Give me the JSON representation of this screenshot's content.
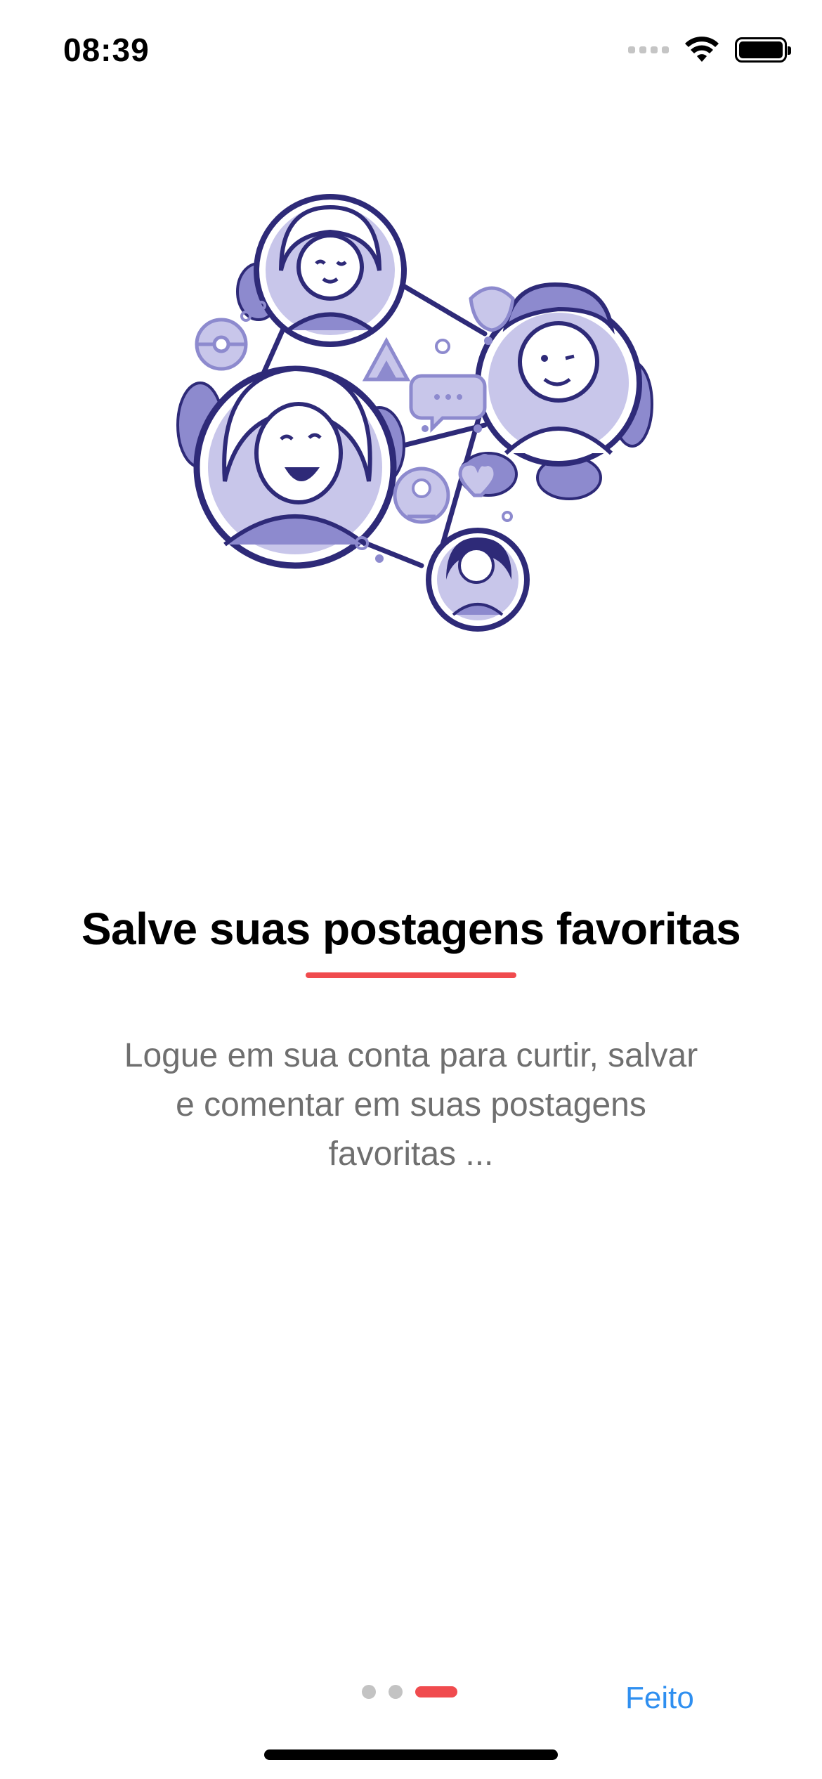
{
  "status_bar": {
    "time": "08:39",
    "icons": [
      "signal-icon",
      "wifi-icon",
      "battery-icon"
    ]
  },
  "illustration": {
    "icon": "social-network-illustration",
    "colors": {
      "stroke": "#2e2a78",
      "fill": "#8d8ace",
      "light_fill": "#c8c6ea"
    }
  },
  "onboarding": {
    "title": "Salve suas postagens favoritas",
    "description": "Logue em sua conta para curtir, salvar e comentar em suas postagens favoritas ...",
    "accent_color": "#f04b4e"
  },
  "pager": {
    "total_pages": 3,
    "current_page": 3
  },
  "done_button": {
    "label": "Feito",
    "color": "#2f8ff0"
  }
}
